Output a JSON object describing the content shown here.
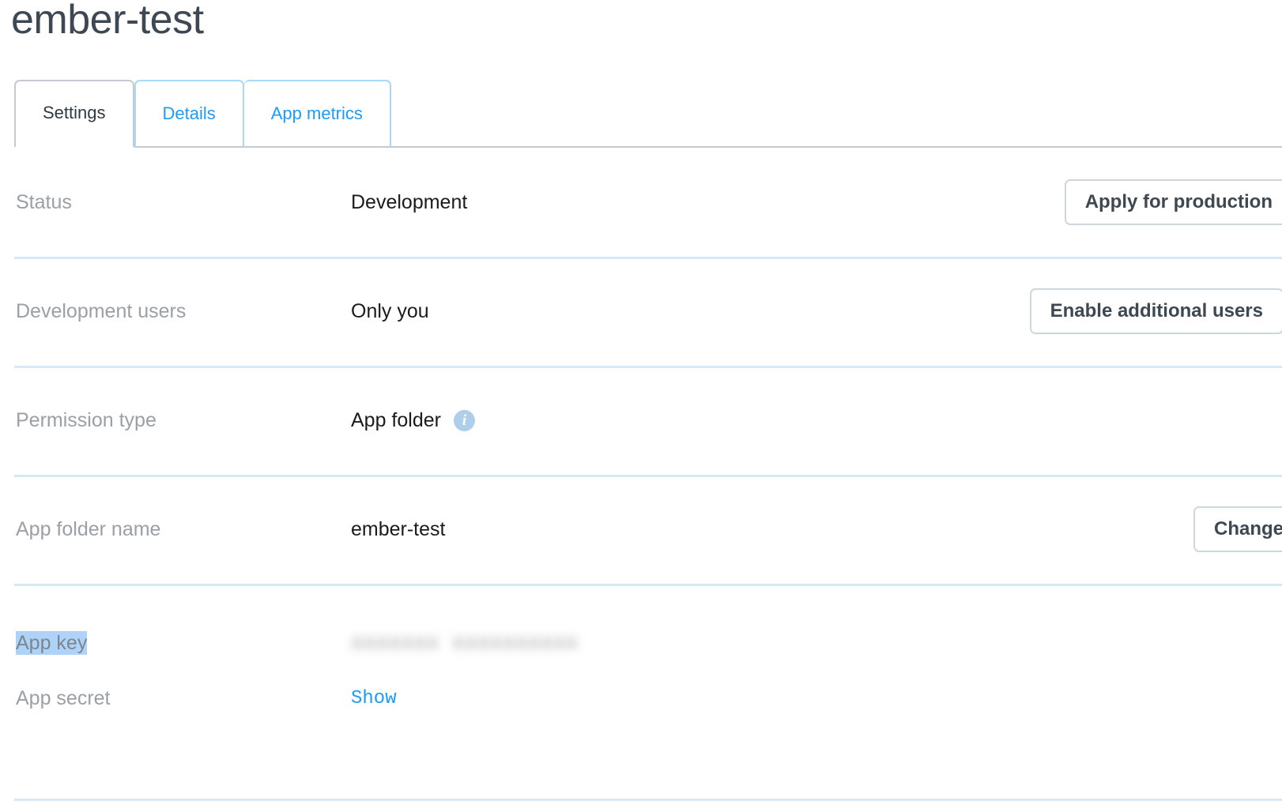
{
  "page": {
    "title": "ember-test",
    "accent_blue": "#1d9bf7",
    "divider_color": "#d6e7f6",
    "tab_border_inactive": "#a8d8fb",
    "tab_border_active": "#c3cad1",
    "label_color": "#9aa0a6",
    "selection_highlight": "#aed3f9"
  },
  "tabs": [
    {
      "label": "Settings",
      "active": true
    },
    {
      "label": "Details",
      "active": false
    },
    {
      "label": "App metrics",
      "active": false
    }
  ],
  "rows": [
    {
      "label": "Status",
      "value": "Development",
      "button": "Apply for production"
    },
    {
      "label": "Development users",
      "value": "Only you",
      "button": "Enable additional users"
    },
    {
      "label": "Permission type",
      "value": "App folder",
      "info_icon": "info-icon",
      "button": ""
    },
    {
      "label": "App folder name",
      "value": "ember-test",
      "button": "Change"
    }
  ],
  "keys": {
    "app_key_label": "App key",
    "app_key_value": "xxxxxxx xxxxxxxxxx",
    "app_secret_label": "App secret",
    "app_secret_action": "Show"
  }
}
